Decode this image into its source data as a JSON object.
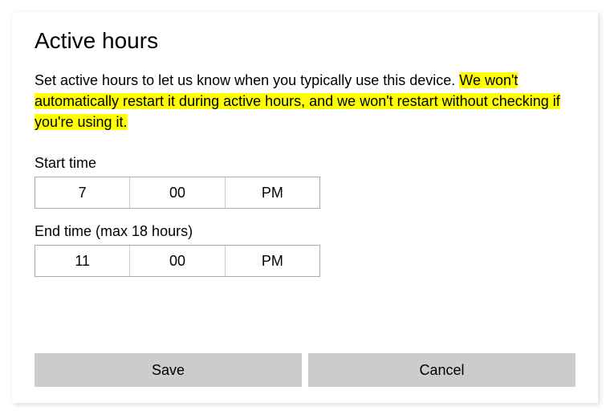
{
  "title": "Active hours",
  "description": {
    "plain": "Set active hours to let us know when you typically use this device. ",
    "highlight": "We won't automatically restart it during active hours, and we won't restart without checking if you're using it."
  },
  "start": {
    "label": "Start time",
    "hour": "7",
    "minute": "00",
    "ampm": "PM"
  },
  "end": {
    "label": "End time (max 18 hours)",
    "hour": "11",
    "minute": "00",
    "ampm": "PM"
  },
  "buttons": {
    "save": "Save",
    "cancel": "Cancel"
  }
}
